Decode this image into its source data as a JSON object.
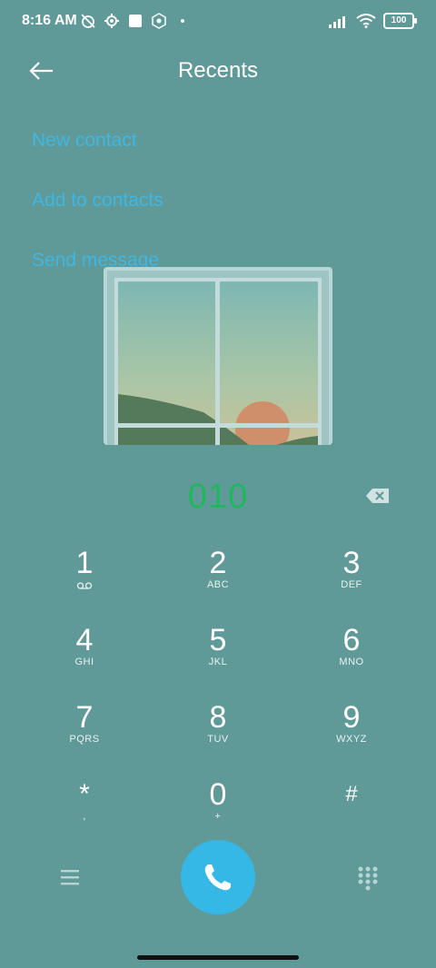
{
  "status_bar": {
    "time": "8:16 AM",
    "battery": "100",
    "left_icons": [
      "alarm-off-icon",
      "settings-icon",
      "square-notification-icon",
      "badge-icon",
      "dot-icon"
    ],
    "right_icons": [
      "signal-icon",
      "wifi-icon",
      "battery-icon"
    ]
  },
  "header": {
    "title": "Recents",
    "back_icon": "arrow-left-icon"
  },
  "options": [
    {
      "label": "New contact"
    },
    {
      "label": "Add to contacts"
    },
    {
      "label": "Send message"
    }
  ],
  "dial_number": "010",
  "keypad": [
    [
      {
        "digit": "1",
        "letters": "voicemail"
      },
      {
        "digit": "2",
        "letters": "ABC"
      },
      {
        "digit": "3",
        "letters": "DEF"
      }
    ],
    [
      {
        "digit": "4",
        "letters": "GHI"
      },
      {
        "digit": "5",
        "letters": "JKL"
      },
      {
        "digit": "6",
        "letters": "MNO"
      }
    ],
    [
      {
        "digit": "7",
        "letters": "PQRS"
      },
      {
        "digit": "8",
        "letters": "TUV"
      },
      {
        "digit": "9",
        "letters": "WXYZ"
      }
    ],
    [
      {
        "digit": "*",
        "letters": ","
      },
      {
        "digit": "0",
        "letters": "+"
      },
      {
        "digit": "#",
        "letters": ""
      }
    ]
  ],
  "colors": {
    "background": "#5f9a98",
    "accent": "#35b8e5",
    "option_text": "#3fb7e4",
    "number_text": "#1db85a"
  }
}
